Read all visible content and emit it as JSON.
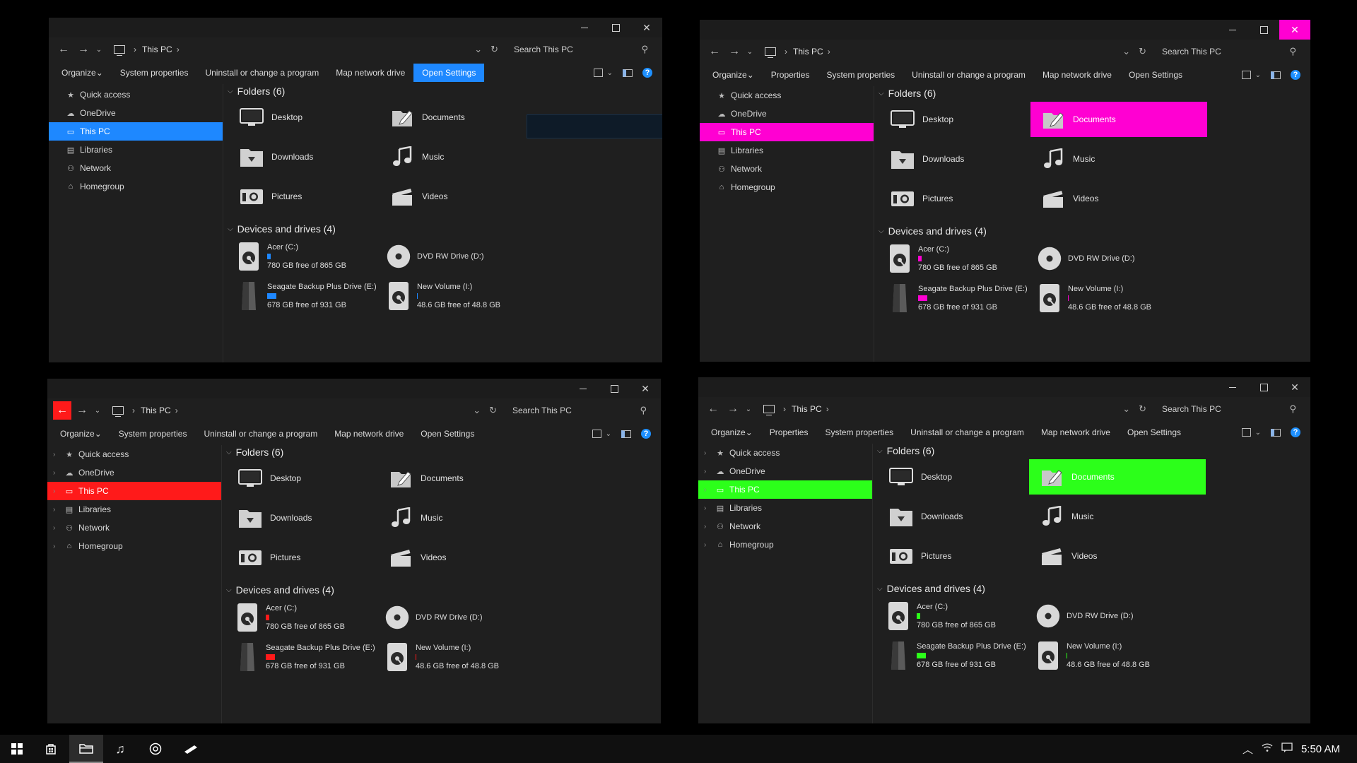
{
  "accents": [
    "#1e88ff",
    "#ff00d2",
    "#ff1a1a",
    "#2cff1a"
  ],
  "windows": [
    {
      "address": {
        "location": "This PC",
        "search_placeholder": "Search This PC"
      },
      "commands": [
        "Organize",
        "System properties",
        "Uninstall or change a program",
        "Map network drive",
        "Open Settings"
      ],
      "highlighted_command": 4,
      "sidebar": [
        "Quick access",
        "OneDrive",
        "This PC",
        "Libraries",
        "Network",
        "Homegroup"
      ],
      "selected_sidebar": 2,
      "folders_header": "Folders (6)",
      "folders": [
        "Desktop",
        "Documents",
        "Downloads",
        "Music",
        "Pictures",
        "Videos"
      ],
      "selected_folder": -1,
      "devices_header": "Devices and drives (4)",
      "drives": [
        {
          "name": "Acer (C:)",
          "free": "780 GB free of 865 GB",
          "used_fraction": 0.1
        },
        {
          "name": "DVD RW Drive (D:)"
        },
        {
          "name": "Seagate Backup Plus Drive (E:)",
          "free": "678 GB free of 931 GB",
          "used_fraction": 0.27
        },
        {
          "name": "New Volume (I:)",
          "free": "48.6 GB free of 48.8 GB",
          "used_fraction": 0.004
        }
      ],
      "controls": {
        "min": "—",
        "max": "☐",
        "close": "✕"
      }
    },
    {
      "address": {
        "location": "This PC",
        "search_placeholder": "Search This PC"
      },
      "commands": [
        "Organize",
        "Properties",
        "System properties",
        "Uninstall or change a program",
        "Map network drive",
        "Open Settings"
      ],
      "highlighted_command": -1,
      "sidebar": [
        "Quick access",
        "OneDrive",
        "This PC",
        "Libraries",
        "Network",
        "Homegroup"
      ],
      "selected_sidebar": 2,
      "folders_header": "Folders (6)",
      "folders": [
        "Desktop",
        "Documents",
        "Downloads",
        "Music",
        "Pictures",
        "Videos"
      ],
      "selected_folder": 1,
      "devices_header": "Devices and drives (4)",
      "drives": [
        {
          "name": "Acer (C:)",
          "free": "780 GB free of 865 GB",
          "used_fraction": 0.1
        },
        {
          "name": "DVD RW Drive (D:)"
        },
        {
          "name": "Seagate Backup Plus Drive (E:)",
          "free": "678 GB free of 931 GB",
          "used_fraction": 0.27
        },
        {
          "name": "New Volume (I:)",
          "free": "48.6 GB free of 48.8 GB",
          "used_fraction": 0.004
        }
      ],
      "controls": {
        "min": "—",
        "max": "☐",
        "close": "✕"
      }
    },
    {
      "address": {
        "location": "This PC",
        "search_placeholder": "Search This PC"
      },
      "commands": [
        "Organize",
        "System properties",
        "Uninstall or change a program",
        "Map network drive",
        "Open Settings"
      ],
      "highlighted_command": -1,
      "sidebar": [
        "Quick access",
        "OneDrive",
        "This PC",
        "Libraries",
        "Network",
        "Homegroup"
      ],
      "selected_sidebar": 2,
      "folders_header": "Folders (6)",
      "folders": [
        "Desktop",
        "Documents",
        "Downloads",
        "Music",
        "Pictures",
        "Videos"
      ],
      "selected_folder": -1,
      "devices_header": "Devices and drives (4)",
      "drives": [
        {
          "name": "Acer (C:)",
          "free": "780 GB free of 865 GB",
          "used_fraction": 0.1
        },
        {
          "name": "DVD RW Drive (D:)"
        },
        {
          "name": "Seagate Backup Plus Drive (E:)",
          "free": "678 GB free of 931 GB",
          "used_fraction": 0.27
        },
        {
          "name": "New Volume (I:)",
          "free": "48.6 GB free of 48.8 GB",
          "used_fraction": 0.004
        }
      ],
      "controls": {
        "min": "—",
        "max": "☐",
        "close": "✕"
      }
    },
    {
      "address": {
        "location": "This PC",
        "search_placeholder": "Search This PC"
      },
      "commands": [
        "Organize",
        "Properties",
        "System properties",
        "Uninstall or change a program",
        "Map network drive",
        "Open Settings"
      ],
      "highlighted_command": -1,
      "sidebar": [
        "Quick access",
        "OneDrive",
        "This PC",
        "Libraries",
        "Network",
        "Homegroup"
      ],
      "selected_sidebar": 2,
      "folders_header": "Folders (6)",
      "folders": [
        "Desktop",
        "Documents",
        "Downloads",
        "Music",
        "Pictures",
        "Videos"
      ],
      "selected_folder": 1,
      "devices_header": "Devices and drives (4)",
      "drives": [
        {
          "name": "Acer (C:)",
          "free": "780 GB free of 865 GB",
          "used_fraction": 0.1
        },
        {
          "name": "DVD RW Drive (D:)"
        },
        {
          "name": "Seagate Backup Plus Drive (E:)",
          "free": "678 GB free of 931 GB",
          "used_fraction": 0.27
        },
        {
          "name": "New Volume (I:)",
          "free": "48.6 GB free of 48.8 GB",
          "used_fraction": 0.004
        }
      ],
      "controls": {
        "min": "—",
        "max": "☐",
        "close": "✕"
      }
    }
  ],
  "taskbar": {
    "items": [
      "windows-start-icon",
      "store-icon",
      "file-explorer-icon",
      "music-icon",
      "chrome-icon",
      "paint-icon"
    ],
    "clock": "5:50 AM"
  }
}
